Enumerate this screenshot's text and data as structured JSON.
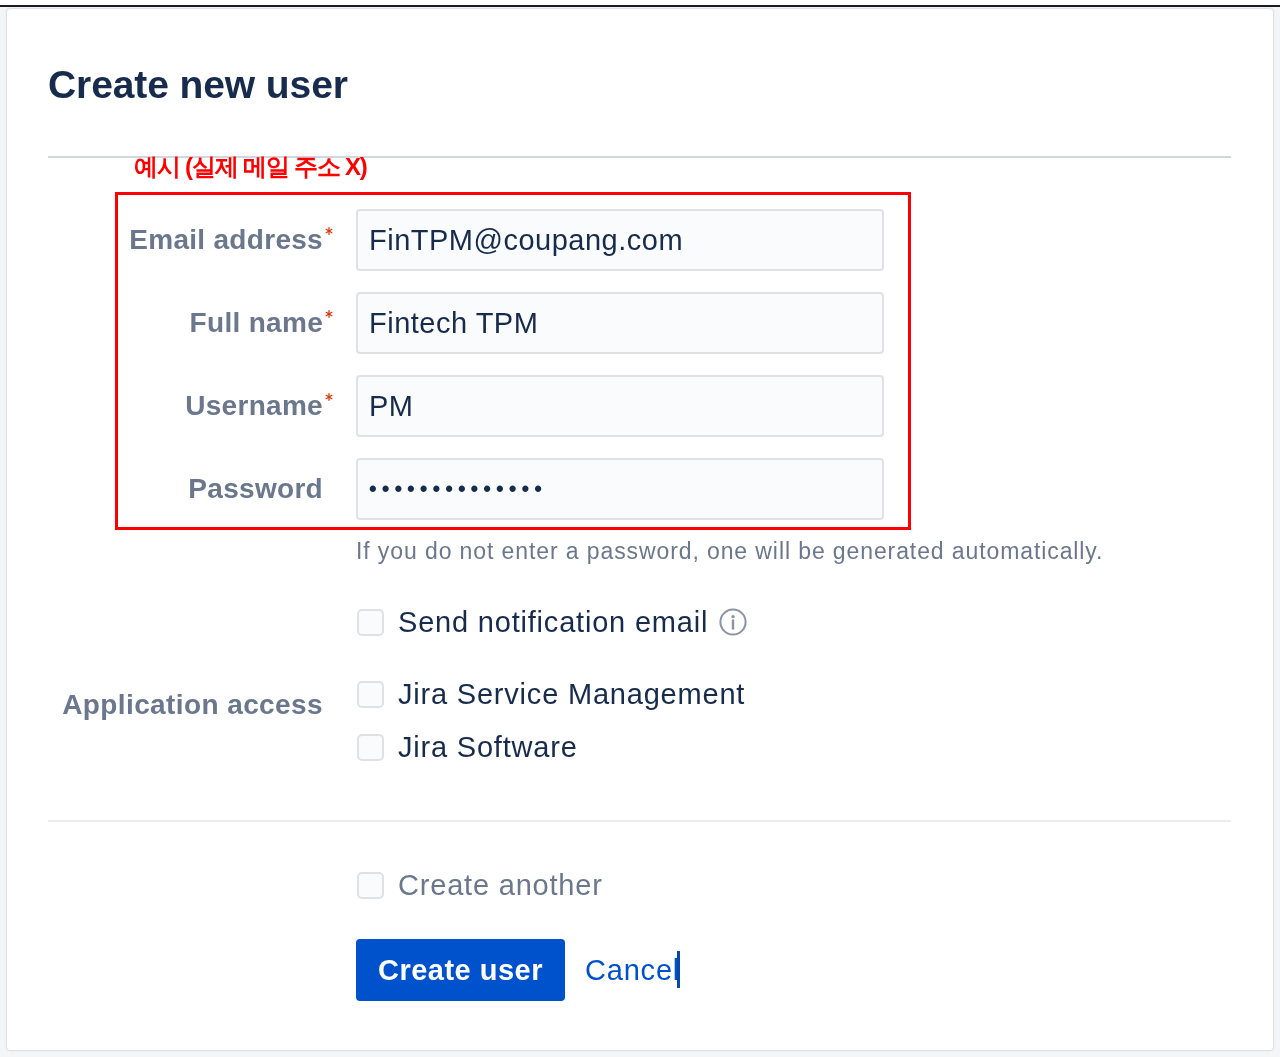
{
  "dialog": {
    "title": "Create new user"
  },
  "annotation": {
    "text": "예시 (실제 메일 주소 X)"
  },
  "fields": [
    {
      "label": "Email address",
      "required": true,
      "kind": "text",
      "value": "FinTPM@coupang.com"
    },
    {
      "label": "Full name",
      "required": true,
      "kind": "text",
      "value": "Fintech TPM"
    },
    {
      "label": "Username",
      "required": true,
      "kind": "text",
      "value": "PM"
    },
    {
      "label": "Password",
      "required": false,
      "kind": "password",
      "value": "••••••••••••••"
    }
  ],
  "password_hint": "If you do not enter a password, one will be generated automatically.",
  "notification": {
    "label": "Send notification email",
    "checked": false
  },
  "application_access": {
    "label": "Application access",
    "options": [
      {
        "label": "Jira Service Management",
        "checked": false
      },
      {
        "label": "Jira Software",
        "checked": false
      }
    ]
  },
  "create_another": {
    "label": "Create another",
    "checked": false
  },
  "actions": {
    "submit": "Create user",
    "cancel": "Cancel",
    "text_cursor": true
  }
}
